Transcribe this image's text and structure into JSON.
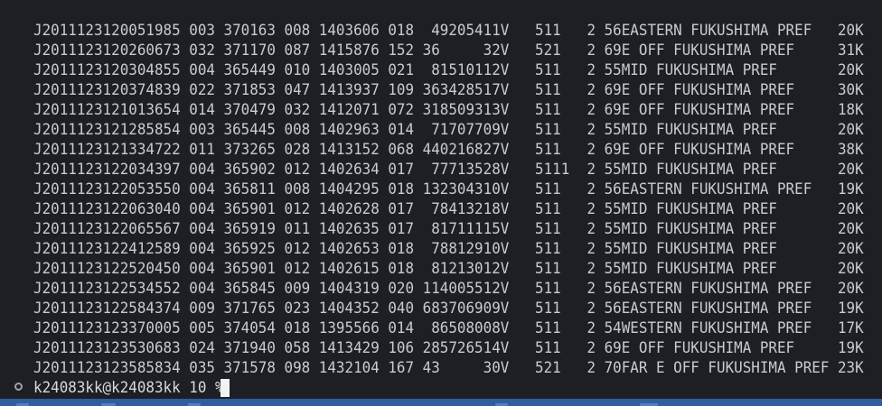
{
  "terminal": {
    "lines": [
      "J2011123120051985 003 370163 008 1403606 018  49205411V   511   2 56EASTERN FUKUSHIMA PREF   20K",
      "J2011123120260673 032 371170 087 1415876 152 36     32V   521   2 69E OFF FUKUSHIMA PREF     31K",
      "J2011123120304855 004 365449 010 1403005 021  81510112V   511   2 55MID FUKUSHIMA PREF       20K",
      "J2011123120374839 022 371853 047 1413937 109 363428517V   511   2 69E OFF FUKUSHIMA PREF     30K",
      "J2011123121013654 014 370479 032 1412071 072 318509313V   511   2 69E OFF FUKUSHIMA PREF     18K",
      "J2011123121285854 003 365445 008 1402963 014  71707709V   511   2 55MID FUKUSHIMA PREF       20K",
      "J2011123121334722 011 373265 028 1413152 068 440216827V   511   2 69E OFF FUKUSHIMA PREF     38K",
      "J2011123122034397 004 365902 012 1402634 017  77713528V   5111  2 55MID FUKUSHIMA PREF       20K",
      "J2011123122053550 004 365811 008 1404295 018 132304310V   511   2 56EASTERN FUKUSHIMA PREF   19K",
      "J2011123122063040 004 365901 012 1402628 017  78413218V   511   2 55MID FUKUSHIMA PREF       20K",
      "J2011123122065567 004 365919 011 1402635 017  81711115V   511   2 55MID FUKUSHIMA PREF       20K",
      "J2011123122412589 004 365925 012 1402653 018  78812910V   511   2 55MID FUKUSHIMA PREF       20K",
      "J2011123122520450 004 365901 012 1402615 018  81213012V   511   2 55MID FUKUSHIMA PREF       20K",
      "J2011123122534552 004 365845 009 1404319 020 114005512V   511   2 56EASTERN FUKUSHIMA PREF   20K",
      "J2011123122584374 009 371765 023 1404352 040 683706909V   511   2 56EASTERN FUKUSHIMA PREF   19K",
      "J2011123123370005 005 374054 018 1395566 014  86508008V   511   2 54WESTERN FUKUSHIMA PREF   17K",
      "J2011123123530683 024 371940 058 1413429 106 285726514V   511   2 69E OFF FUKUSHIMA PREF     19K",
      "J2011123123585834 035 371578 098 1432104 167 43     30V   521   2 70FAR E OFF FUKUSHIMA PREF 23K"
    ],
    "prompt": "k24083kk@k24083kk 10 % "
  },
  "colors": {
    "background": "#1e1f24",
    "text": "#c9cbd0",
    "cursor": "#f2f2f2",
    "taskbar": "#2e5e9c"
  }
}
